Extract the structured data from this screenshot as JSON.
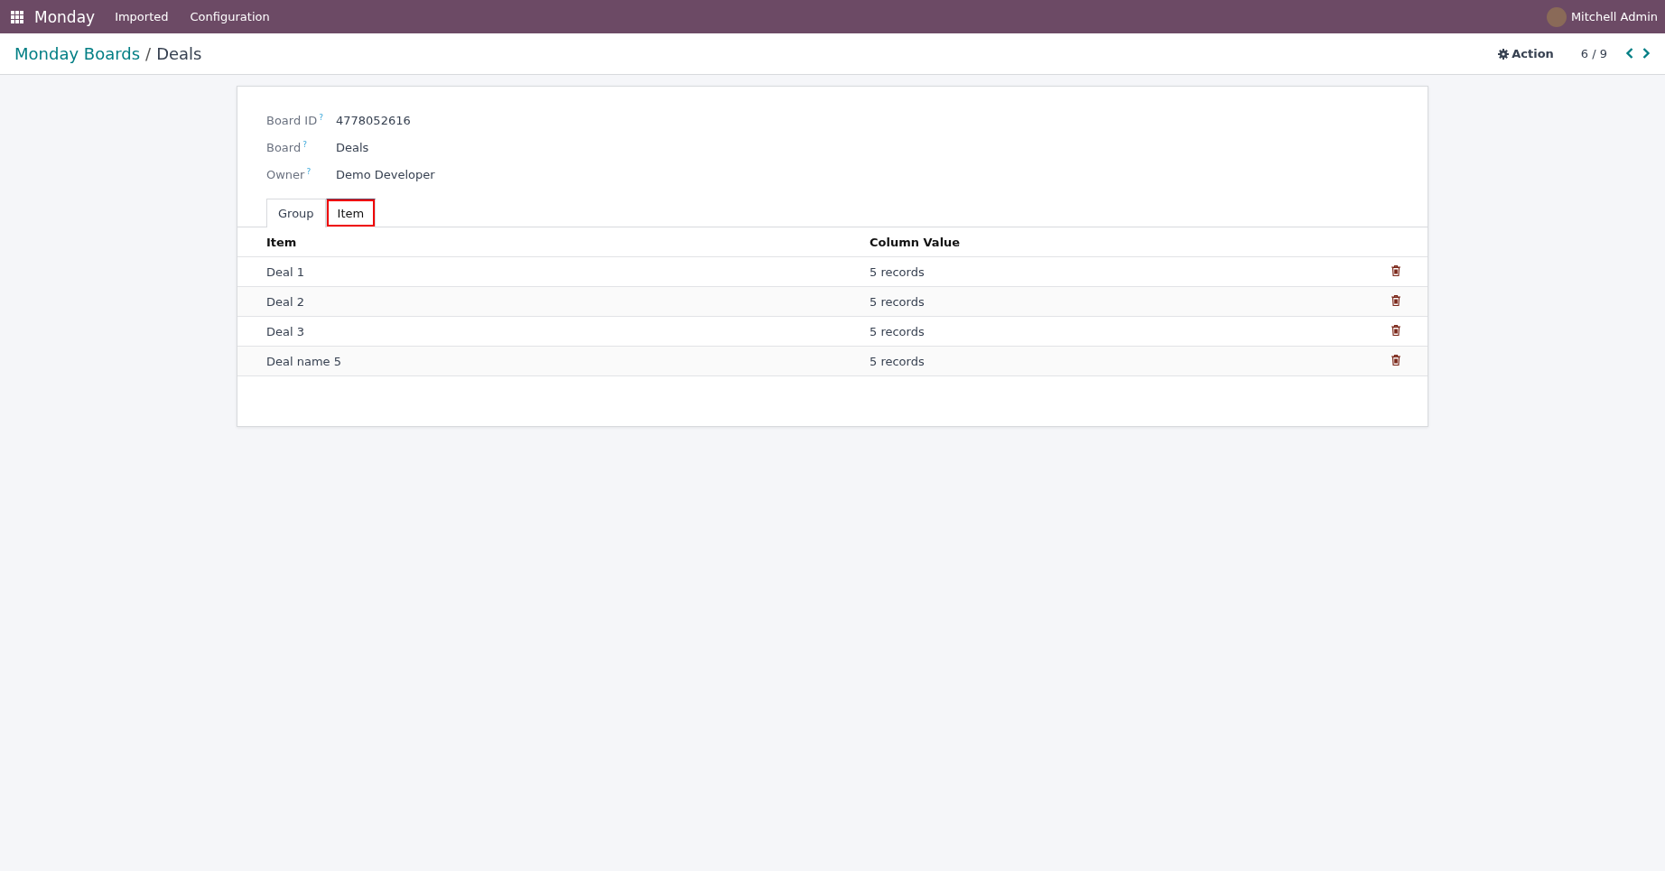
{
  "navbar": {
    "app": "Monday",
    "menus": [
      "Imported",
      "Configuration"
    ],
    "user": "Mitchell Admin"
  },
  "breadcrumb": {
    "parent": "Monday Boards",
    "separator": "/",
    "current": "Deals"
  },
  "control": {
    "action": "Action",
    "pager": "6 / 9"
  },
  "fields": [
    {
      "label": "Board ID",
      "help": "?",
      "value": "4778052616"
    },
    {
      "label": "Board",
      "help": "?",
      "value": "Deals"
    },
    {
      "label": "Owner",
      "help": "?",
      "value": "Demo Developer"
    }
  ],
  "tabs": [
    {
      "label": "Group",
      "selected": false,
      "annotated": false
    },
    {
      "label": "Item",
      "selected": true,
      "annotated": true
    }
  ],
  "table": {
    "columns": [
      "Item",
      "Column Value"
    ],
    "rows": [
      {
        "item": "Deal 1",
        "value": "5 records"
      },
      {
        "item": "Deal 2",
        "value": "5 records"
      },
      {
        "item": "Deal 3",
        "value": "5 records"
      },
      {
        "item": "Deal name 5",
        "value": "5 records"
      }
    ]
  }
}
